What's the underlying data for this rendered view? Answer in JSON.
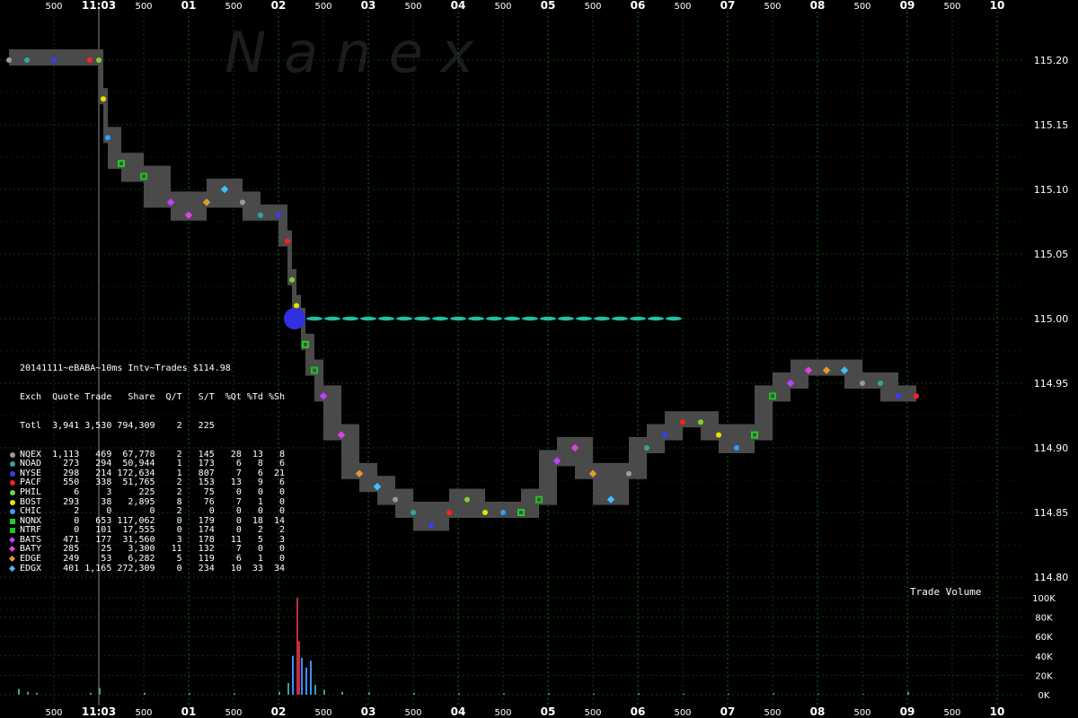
{
  "watermark": "N a n e x",
  "chart_data": {
    "type": "scatter",
    "title": "20141111~eBABA~10ms Intv~Trades $114.98",
    "x_axis": {
      "tick_labels": [
        "500",
        "11:03",
        "500",
        "01",
        "500",
        "02",
        "500",
        "03",
        "500",
        "04",
        "500",
        "05",
        "500",
        "06",
        "500",
        "07",
        "500",
        "08",
        "500",
        "09",
        "500",
        "10"
      ],
      "major_labels": [
        "01",
        "02",
        "03",
        "04",
        "05",
        "06",
        "07",
        "08",
        "09",
        "10"
      ],
      "note": "half-second ticks labeled 500, whole seconds labeled 01-10 after 11:03"
    },
    "price_axis": {
      "ticks": [
        "115.20",
        "115.15",
        "115.10",
        "115.05",
        "115.00",
        "114.95",
        "114.90",
        "114.85",
        "114.80"
      ],
      "ylim": [
        114.8,
        115.22
      ]
    },
    "volume_axis": {
      "label": "Trade Volume",
      "ticks": [
        "100K",
        "80K",
        "60K",
        "40K",
        "20K",
        "0K"
      ],
      "ylim": [
        0,
        100000
      ]
    },
    "price_trace": {
      "x": [
        0.0,
        0.2,
        0.5,
        0.9,
        1.0,
        1.05,
        1.1,
        1.25,
        1.5,
        1.8,
        2.0,
        2.2,
        2.4,
        2.6,
        2.8,
        3.0,
        3.1,
        3.15,
        3.2,
        3.25,
        3.3,
        3.4,
        3.5,
        3.7,
        3.9,
        4.1,
        4.3,
        4.5,
        4.7,
        4.9,
        5.1,
        5.3,
        5.5,
        5.7,
        5.9,
        6.1,
        6.3,
        6.5,
        6.7,
        6.9,
        7.1,
        7.3,
        7.5,
        7.7,
        7.9,
        8.1,
        8.3,
        8.5,
        8.7,
        8.9,
        9.1,
        9.3,
        9.5,
        9.7,
        9.9,
        10.1
      ],
      "y": [
        115.2,
        115.2,
        115.2,
        115.2,
        115.2,
        115.17,
        115.14,
        115.12,
        115.11,
        115.09,
        115.08,
        115.09,
        115.1,
        115.09,
        115.08,
        115.08,
        115.06,
        115.03,
        115.01,
        115.0,
        114.98,
        114.96,
        114.94,
        114.91,
        114.88,
        114.87,
        114.86,
        114.85,
        114.84,
        114.85,
        114.86,
        114.85,
        114.85,
        114.85,
        114.86,
        114.89,
        114.9,
        114.88,
        114.86,
        114.88,
        114.9,
        114.91,
        114.92,
        114.92,
        114.91,
        114.9,
        114.91,
        114.94,
        114.95,
        114.96,
        114.96,
        114.96,
        114.95,
        114.95,
        114.94,
        114.94
      ]
    },
    "bid_line": {
      "x": [
        3.4,
        3.6,
        3.8,
        4.0,
        4.2,
        4.4,
        4.6,
        4.8,
        5.0,
        5.2,
        5.4,
        5.6,
        5.8,
        6.0,
        6.2,
        6.4,
        6.6,
        6.8,
        7.0,
        7.2,
        7.4
      ],
      "y": [
        115.0,
        115.0,
        115.0,
        115.0,
        115.0,
        115.0,
        115.0,
        115.0,
        115.0,
        115.0,
        115.0,
        115.0,
        115.0,
        115.0,
        115.0,
        115.0,
        115.0,
        115.0,
        115.0,
        115.0,
        115.0
      ]
    },
    "volume_bars": {
      "x": [
        0.1,
        0.2,
        0.3,
        0.9,
        1.0,
        1.5,
        2.0,
        2.5,
        3.0,
        3.1,
        3.15,
        3.2,
        3.22,
        3.25,
        3.3,
        3.35,
        3.4,
        3.5,
        3.7,
        4.0,
        4.5,
        5.0,
        5.5,
        6.0,
        6.5,
        7.0,
        7.5,
        8.0,
        8.5,
        9.0,
        9.5,
        10.0
      ],
      "y": [
        6000,
        3000,
        2000,
        2000,
        7000,
        2000,
        1500,
        1500,
        3000,
        12000,
        40000,
        100000,
        55000,
        38000,
        28000,
        35000,
        10000,
        5000,
        3000,
        2500,
        2000,
        1500,
        1500,
        1500,
        1200,
        1500,
        1200,
        1000,
        1500,
        1000,
        800,
        3000
      ]
    },
    "legend": {
      "columns": [
        "Exch",
        "Quote",
        "Trade",
        "Share",
        "Q/T",
        "S/T",
        "%Qt",
        "%Td",
        "%Sh"
      ],
      "total": [
        "Totl",
        "3,941",
        "3,530",
        "794,309",
        "2",
        "225",
        "",
        "",
        ""
      ],
      "rows": [
        {
          "exch": "NQEX",
          "quote": "1,113",
          "trade": "469",
          "share": "67,778",
          "qt": "2",
          "st": "145",
          "pqt": "28",
          "ptd": "13",
          "psh": "8",
          "color": "#9a9a9a",
          "shape": "circle"
        },
        {
          "exch": "NOAD",
          "quote": "273",
          "trade": "294",
          "share": "50,944",
          "qt": "1",
          "st": "173",
          "pqt": "6",
          "ptd": "8",
          "psh": "6",
          "color": "#2ea8a0",
          "shape": "circle"
        },
        {
          "exch": "NYSE",
          "quote": "298",
          "trade": "214",
          "share": "172,634",
          "qt": "1",
          "st": "807",
          "pqt": "7",
          "ptd": "6",
          "psh": "21",
          "color": "#3b3bff",
          "shape": "circle"
        },
        {
          "exch": "PACF",
          "quote": "550",
          "trade": "338",
          "share": "51,765",
          "qt": "2",
          "st": "153",
          "pqt": "13",
          "ptd": "9",
          "psh": "6",
          "color": "#ff2020",
          "shape": "circle"
        },
        {
          "exch": "PHIL",
          "quote": "6",
          "trade": "3",
          "share": "225",
          "qt": "2",
          "st": "75",
          "pqt": "0",
          "ptd": "0",
          "psh": "0",
          "color": "#7ad23a",
          "shape": "circle"
        },
        {
          "exch": "BOST",
          "quote": "293",
          "trade": "38",
          "share": "2,895",
          "qt": "8",
          "st": "76",
          "pqt": "7",
          "ptd": "1",
          "psh": "0",
          "color": "#e6e600",
          "shape": "circle"
        },
        {
          "exch": "CHIC",
          "quote": "2",
          "trade": "0",
          "share": "0",
          "qt": "2",
          "st": "0",
          "pqt": "0",
          "ptd": "0",
          "psh": "0",
          "color": "#30a0ff",
          "shape": "circle"
        },
        {
          "exch": "NQNX",
          "quote": "0",
          "trade": "653",
          "share": "117,062",
          "qt": "0",
          "st": "179",
          "pqt": "0",
          "ptd": "18",
          "psh": "14",
          "color": "#20d020",
          "shape": "square"
        },
        {
          "exch": "NTRF",
          "quote": "0",
          "trade": "101",
          "share": "17,555",
          "qt": "0",
          "st": "174",
          "pqt": "0",
          "ptd": "2",
          "psh": "2",
          "color": "#20c020",
          "shape": "square"
        },
        {
          "exch": "BATS",
          "quote": "471",
          "trade": "177",
          "share": "31,560",
          "qt": "3",
          "st": "178",
          "pqt": "11",
          "ptd": "5",
          "psh": "3",
          "color": "#c040ff",
          "shape": "diamond"
        },
        {
          "exch": "BATY",
          "quote": "285",
          "trade": "25",
          "share": "3,300",
          "qt": "11",
          "st": "132",
          "pqt": "7",
          "ptd": "0",
          "psh": "0",
          "color": "#e040e0",
          "shape": "diamond"
        },
        {
          "exch": "EDGE",
          "quote": "249",
          "trade": "53",
          "share": "6,282",
          "qt": "5",
          "st": "119",
          "pqt": "6",
          "ptd": "1",
          "psh": "0",
          "color": "#e09a30",
          "shape": "diamond"
        },
        {
          "exch": "EDGX",
          "quote": "401",
          "trade": "1,165",
          "share": "272,309",
          "qt": "0",
          "st": "234",
          "pqt": "10",
          "ptd": "33",
          "psh": "34",
          "color": "#40c0ff",
          "shape": "diamond"
        }
      ]
    },
    "grid": true
  },
  "colors": {
    "background": "#000000",
    "grid": "#1a6a1a",
    "grid_minor": "#0d3a0d",
    "quote_band": "#4a4a4a",
    "bid_line": "#20c0a0",
    "text": "#ffffff"
  }
}
